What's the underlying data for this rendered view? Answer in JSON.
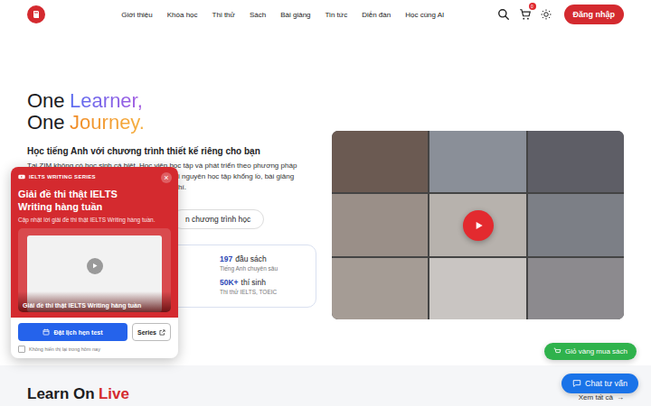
{
  "header": {
    "nav": [
      "Giới thiệu",
      "Khóa học",
      "Thi thử",
      "Sách",
      "Bài giảng",
      "Tin tức",
      "Diễn đàn",
      "Học cùng AI"
    ],
    "cart_badge": "0",
    "login": "Đăng nhập"
  },
  "hero": {
    "title": [
      {
        "lead": "One",
        "accent": "Learner,",
        "kind": "blue"
      },
      {
        "lead": "One",
        "accent": "Journey.",
        "kind": "orange"
      }
    ],
    "subtitle": "Học tiếng Anh với chương trình thiết kế riêng cho bạn",
    "paragraph_lines": [
      "Tại ZIM không có học sinh cá biệt. Học viên học tập và phát triển theo phương pháp",
      "i nguyên học tập khổng lồ, bài giảng",
      "hí."
    ],
    "cta": "n chương trình học",
    "stats": [
      {
        "value": "197",
        "label": "đầu sách",
        "caption": "Tiếng Anh chuyên sâu"
      },
      {
        "value": "50K+",
        "label": "thí sinh",
        "caption": "Thi thử IELTS, TOEIC"
      }
    ]
  },
  "popup": {
    "series": "IELTS WRITING SERIES",
    "close": "×",
    "title": "Giải đề thi thật IELTS Writing hàng tuần",
    "subtitle": "Cập nhật lời giải đề thi thật IELTS Writing hàng tuần.",
    "caption": "Giải đề thi thật IELTS Writing hàng tuần",
    "primary_button": "Đặt lịch hẹn test",
    "secondary_button": "Series",
    "checkbox": {
      "label": "Không hiển thị lại trong hôm nay",
      "checked": false
    }
  },
  "floating": [
    {
      "label": "Giỏ vàng mua sách",
      "color": "#2fb24c"
    },
    {
      "label": "Chat tư vấn",
      "color": "#1a73e8"
    }
  ],
  "section": {
    "title_lead": "Learn On",
    "title_accent": "Live",
    "see_all": "Xem tất cả",
    "arrow": "→"
  }
}
